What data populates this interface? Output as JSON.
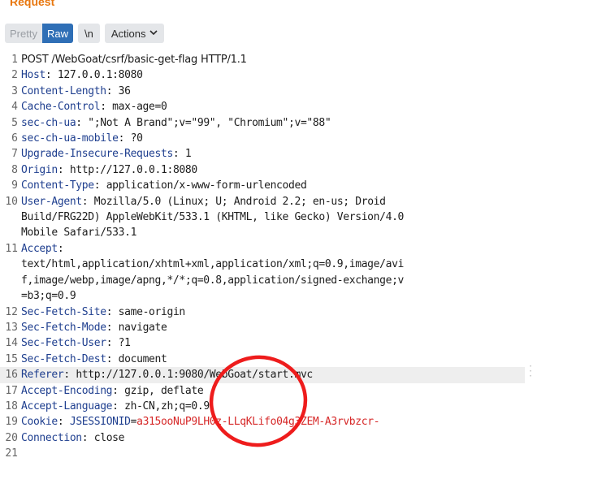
{
  "panel": {
    "title": "Request"
  },
  "toolbar": {
    "pretty_label": "Pretty",
    "raw_label": "Raw",
    "newline_label": "\\n",
    "actions_label": "Actions",
    "actions_chevron": "⌵"
  },
  "request": {
    "line1": {
      "num": "1",
      "method_line": "POST /WebGoat/csrf/basic-get-flag HTTP/1.1"
    },
    "line2": {
      "num": "2",
      "name": "Host",
      "value": "127.0.0.1:8080"
    },
    "line3": {
      "num": "3",
      "name": "Content-Length",
      "value": "36"
    },
    "line4": {
      "num": "4",
      "name": "Cache-Control",
      "value": "max-age=0"
    },
    "line5": {
      "num": "5",
      "name": "sec-ch-ua",
      "value": "\";Not A Brand\";v=\"99\", \"Chromium\";v=\"88\""
    },
    "line6": {
      "num": "6",
      "name": "sec-ch-ua-mobile",
      "value": "?0"
    },
    "line7": {
      "num": "7",
      "name": "Upgrade-Insecure-Requests",
      "value": "1"
    },
    "line8": {
      "num": "8",
      "name": "Origin",
      "value": "http://127.0.0.1:8080"
    },
    "line9": {
      "num": "9",
      "name": "Content-Type",
      "value": "application/x-www-form-urlencoded"
    },
    "line10": {
      "num": "10",
      "name": "User-Agent",
      "value_1": "Mozilla/5.0 (Linux; U; Android 2.2; en-us; Droid",
      "value_2": "Build/FRG22D) AppleWebKit/533.1 (KHTML, like Gecko) Version/4.0",
      "value_3": "Mobile Safari/533.1"
    },
    "line11": {
      "num": "11",
      "name": "Accept",
      "value_1": "text/html,application/xhtml+xml,application/xml;q=0.9,image/avi",
      "value_2": "f,image/webp,image/apng,*/*;q=0.8,application/signed-exchange;v",
      "value_3": "=b3;q=0.9"
    },
    "line12": {
      "num": "12",
      "name": "Sec-Fetch-Site",
      "value": "same-origin"
    },
    "line13": {
      "num": "13",
      "name": "Sec-Fetch-Mode",
      "value": "navigate"
    },
    "line14": {
      "num": "14",
      "name": "Sec-Fetch-User",
      "value": "?1"
    },
    "line15": {
      "num": "15",
      "name": "Sec-Fetch-Dest",
      "value": "document"
    },
    "line16": {
      "num": "16",
      "name": "Referer",
      "value": "http://127.0.0.1:9080/WebGoat/start.mvc"
    },
    "line17": {
      "num": "17",
      "name": "Accept-Encoding",
      "value": "gzip, deflate"
    },
    "line18": {
      "num": "18",
      "name": "Accept-Language",
      "value": "zh-CN,zh;q=0.9"
    },
    "line19": {
      "num": "19",
      "name": "Cookie",
      "cookie_name": "JSESSIONID",
      "cookie_value": "a315ooNuP9LH0z-LLqKLifo04g3ZEM-A3rvbzcr-"
    },
    "line20": {
      "num": "20",
      "name": "Connection",
      "value": "close"
    },
    "line21": {
      "num": "21"
    }
  },
  "annotation_color": "#ee1c1c",
  "header_name_color": "#1f3f8f",
  "cookie_value_color": "#d62828"
}
